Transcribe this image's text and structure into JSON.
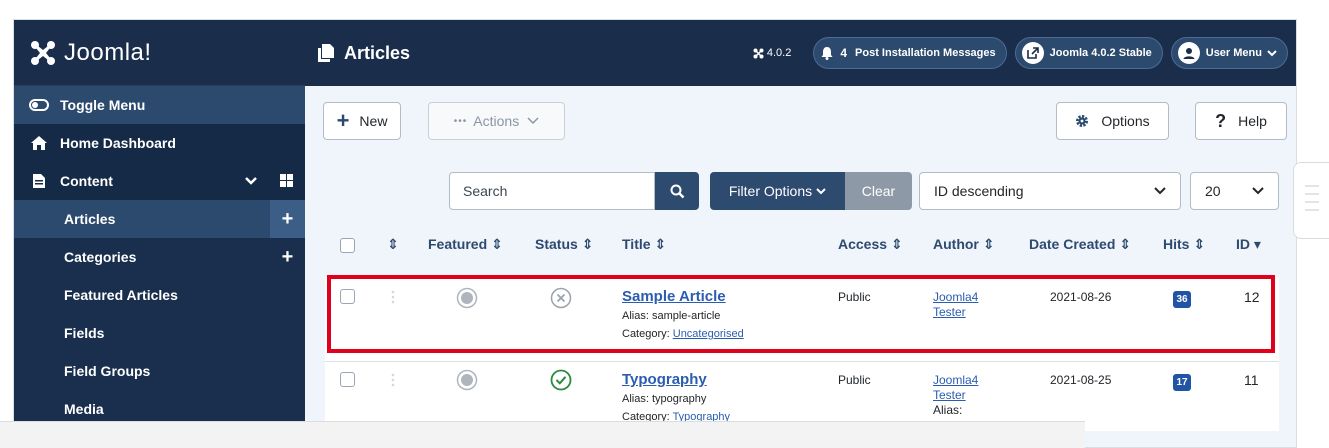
{
  "brand": {
    "name": "Joomla!"
  },
  "sidebar": {
    "toggle": "Toggle Menu",
    "home": "Home Dashboard",
    "content": "Content",
    "items": [
      {
        "label": "Articles",
        "has_add": true,
        "active": true
      },
      {
        "label": "Categories",
        "has_add": true,
        "active": false
      },
      {
        "label": "Featured Articles",
        "has_add": false,
        "active": false
      },
      {
        "label": "Fields",
        "has_add": false,
        "active": false
      },
      {
        "label": "Field Groups",
        "has_add": false,
        "active": false
      },
      {
        "label": "Media",
        "has_add": false,
        "active": false
      }
    ]
  },
  "header": {
    "title": "Articles",
    "version": "4.0.2",
    "notifications_count": "4",
    "post_install": "Post Installation Messages",
    "site_link": "Joomla 4.0.2 Stable",
    "user_menu": "User Menu"
  },
  "toolbar": {
    "new": "New",
    "actions": "Actions",
    "options": "Options",
    "help": "Help"
  },
  "filters": {
    "search_placeholder": "Search",
    "filter_options": "Filter Options",
    "clear": "Clear",
    "sort": "ID descending",
    "limit": "20"
  },
  "table": {
    "headers": {
      "featured": "Featured",
      "status": "Status",
      "title": "Title",
      "access": "Access",
      "author": "Author",
      "date_created": "Date Created",
      "hits": "Hits",
      "id": "ID"
    },
    "rows": [
      {
        "title": "Sample Article",
        "alias": "Alias: sample-article",
        "category_label": "Category: ",
        "category": "Uncategorised",
        "access": "Public",
        "author_line1": "Joomla4",
        "author_line2": "Tester",
        "author_alias": "",
        "date": "2021-08-26",
        "hits": "36",
        "id": "12",
        "status": "unpublished"
      },
      {
        "title": "Typography",
        "alias": "Alias: typography",
        "category_label": "Category: ",
        "category": "Typography",
        "access": "Public",
        "author_line1": "Joomla4",
        "author_line2": "Tester",
        "author_alias": "Alias:",
        "date": "2021-08-25",
        "hits": "17",
        "id": "11",
        "status": "published"
      }
    ]
  },
  "colors": {
    "sidebar_bg": "#152a47",
    "header_bg": "#1a2d4a",
    "primary": "#2d4a6f",
    "highlight": "#e0001b",
    "link": "#2a5db0",
    "published": "#2b8a3e"
  }
}
